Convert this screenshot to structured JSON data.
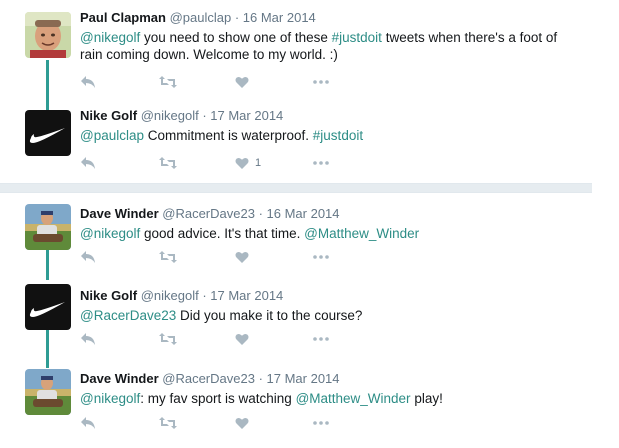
{
  "colors": {
    "link": "#2d8d86",
    "connector": "#2e9c94",
    "separator": "#e6ecf0",
    "action_icon": "#aab8c2"
  },
  "tweets": [
    {
      "name": "Paul Clapman",
      "handle": "@paulclap",
      "date": "· 16 Mar 2014",
      "avatar": "paul-avatar-icon",
      "text": [
        {
          "t": "@nikegolf",
          "link": true
        },
        {
          "t": " you need to show one of these ",
          "link": false
        },
        {
          "t": "#justdoit",
          "link": true
        },
        {
          "t": " tweets when there's a foot of rain coming down.  Welcome to my world.  :)",
          "link": false
        }
      ],
      "like_count": ""
    },
    {
      "name": "Nike Golf",
      "handle": "@nikegolf",
      "date": "· 17 Mar 2014",
      "avatar": "nike-swoosh-icon",
      "text": [
        {
          "t": "@paulclap",
          "link": true
        },
        {
          "t": " Commitment is waterproof. ",
          "link": false
        },
        {
          "t": "#justdoit",
          "link": true
        }
      ],
      "like_count": "1"
    },
    {
      "name": "Dave Winder",
      "handle": "@RacerDave23",
      "date": "· 16 Mar 2014",
      "avatar": "dave-avatar-icon",
      "text": [
        {
          "t": "@nikegolf",
          "link": true
        },
        {
          "t": " good advice. It's that time.  ",
          "link": false
        },
        {
          "t": "@Matthew_Winder",
          "link": true
        }
      ],
      "like_count": ""
    },
    {
      "name": "Nike Golf",
      "handle": "@nikegolf",
      "date": "· 17 Mar 2014",
      "avatar": "nike-swoosh-icon",
      "text": [
        {
          "t": "@RacerDave23",
          "link": true
        },
        {
          "t": " Did you make it to the course?",
          "link": false
        }
      ],
      "like_count": ""
    },
    {
      "name": "Dave Winder",
      "handle": "@RacerDave23",
      "date": "· 17 Mar 2014",
      "avatar": "dave-avatar-icon",
      "text": [
        {
          "t": "@nikegolf",
          "link": true
        },
        {
          "t": ": my fav sport is watching ",
          "link": false
        },
        {
          "t": "@Matthew_Winder",
          "link": true
        },
        {
          "t": " play!",
          "link": false
        }
      ],
      "like_count": ""
    }
  ]
}
